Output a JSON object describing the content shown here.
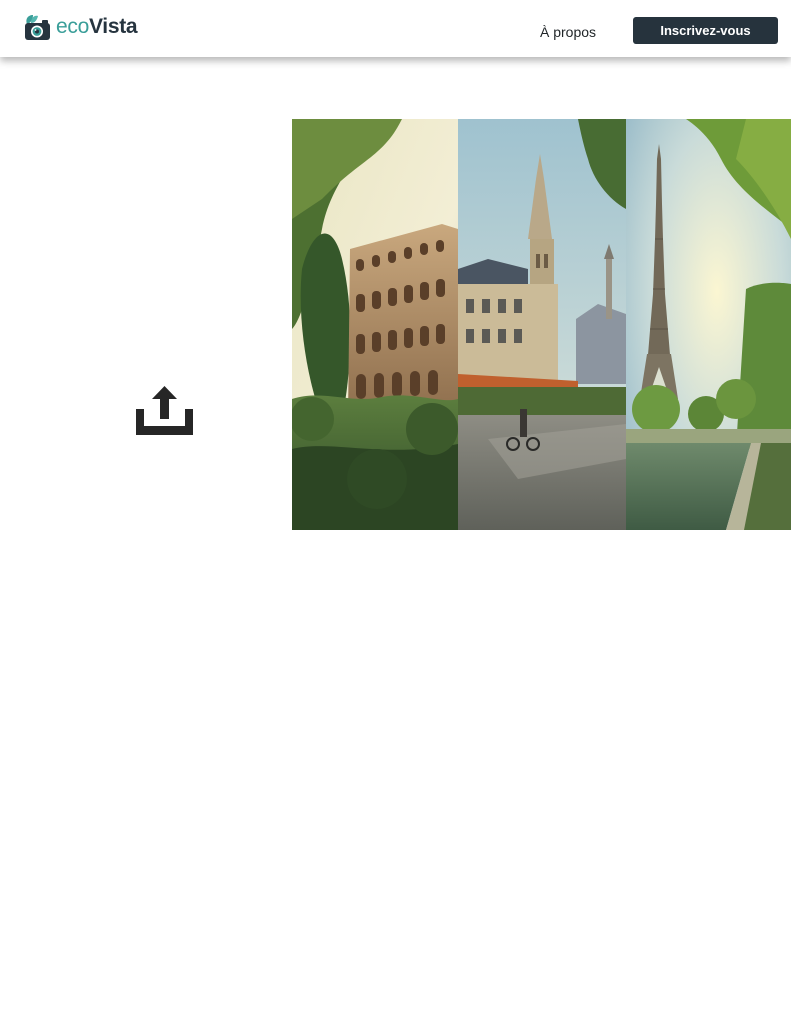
{
  "header": {
    "brand_eco": "eco",
    "brand_vista": "Vista",
    "about_label": "À propos",
    "signup_label": "Inscrivez-vous"
  },
  "icons": {
    "logo": "camera-leaf-icon",
    "upload": "upload-icon"
  },
  "colors": {
    "brand_teal": "#3a9e99",
    "brand_dark": "#26343f",
    "button_bg": "#26333d",
    "button_text": "#ffffff",
    "icon_dark": "#262626"
  }
}
